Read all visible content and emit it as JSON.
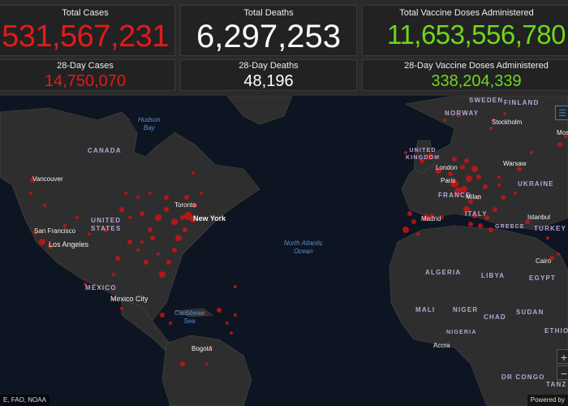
{
  "stats": {
    "total_cases": {
      "label": "Total Cases",
      "value": "531,567,231"
    },
    "total_deaths": {
      "label": "Total Deaths",
      "value": "6,297,253"
    },
    "total_vaccines": {
      "label": "Total Vaccine Doses Administered",
      "value": "11,653,556,780"
    },
    "cases_28": {
      "label": "28-Day Cases",
      "value": "14,750,070"
    },
    "deaths_28": {
      "label": "28-Day Deaths",
      "value": "48,196"
    },
    "vaccines_28": {
      "label": "28-Day Vaccine Doses Administered",
      "value": "338,204,339"
    }
  },
  "colors": {
    "cases": "#e31a1a",
    "deaths": "#ffffff",
    "vaccines": "#70d71c",
    "map_background": "#0d1522",
    "land": "#2e2e2e"
  },
  "map": {
    "countries": {
      "canada": "CANADA",
      "united_states": "UNITED\nSTATES",
      "mexico": "MÉXICO",
      "sweden": "SWEDEN",
      "finland": "FINLAND",
      "norway": "NORWAY",
      "united_kingdom": "UNITED\nKINGDOM",
      "france": "FRANCE",
      "ukraine": "UKRAINE",
      "italy": "ITALY",
      "greece": "GREECE",
      "turkey": "TURKEY",
      "algeria": "ALGERIA",
      "libya": "LIBYA",
      "egypt": "EGYPT",
      "mali": "MALI",
      "niger": "NIGER",
      "chad": "CHAD",
      "sudan": "SUDAN",
      "nigeria": "NIGERIA",
      "ethiopia": "ETHIO",
      "dr_congo": "DR CONGO",
      "tanzania": "TANZ"
    },
    "cities": {
      "vancouver": "Vancouver",
      "san_francisco": "San Francisco",
      "los_angeles": "Los Angeles",
      "toronto": "Toronto",
      "new_york": "New York",
      "mexico_city": "Mexico City",
      "bogota": "Bogotá",
      "london": "London",
      "paris": "Paris",
      "madrid": "Madrid",
      "milan": "Milan",
      "warsaw": "Warsaw",
      "stockholm": "Stockholm",
      "istanbul": "Istanbul",
      "cairo": "Cairo",
      "accra": "Accra",
      "moscow": "Mos"
    },
    "water": {
      "hudson_bay": "Hudson\nBay",
      "north_atlantic": "North Atlantic\nOcean",
      "caribbean": "Caribbean\nSea"
    }
  },
  "footer": {
    "attribution": "E, FAO, NOAA",
    "powered_by": "Powered by"
  },
  "controls": {
    "zoom_in": "+",
    "zoom_out": "−",
    "list_icon": "list-icon"
  }
}
